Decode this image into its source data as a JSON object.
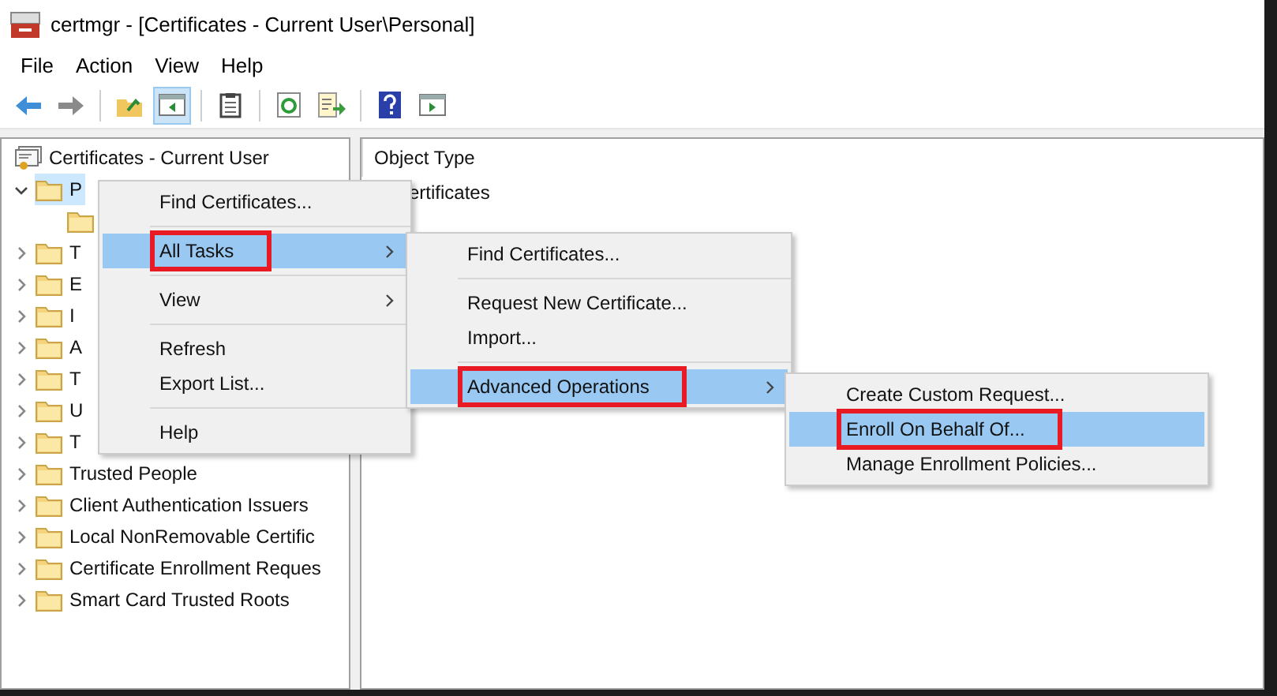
{
  "window": {
    "title": "certmgr - [Certificates - Current User\\Personal]"
  },
  "menu_bar": [
    "File",
    "Action",
    "View",
    "Help"
  ],
  "toolbar": [
    {
      "pressed": false
    },
    {
      "pressed": false
    },
    {
      "pressed": false
    },
    {
      "pressed": true
    },
    {
      "pressed": false
    },
    {
      "pressed": false
    },
    {
      "pressed": false
    },
    {
      "pressed": false
    },
    {
      "pressed": false
    }
  ],
  "tree": {
    "label": "Certificates - Current User",
    "children": [
      {
        "label": "P",
        "expanded": true,
        "selected": true,
        "children": [
          {
            "selected": false
          }
        ]
      },
      {
        "label": "T",
        "expanded": false,
        "selected": false
      },
      {
        "label": "E",
        "expanded": false,
        "selected": false
      },
      {
        "label": "I",
        "expanded": false,
        "selected": false
      },
      {
        "label": "A",
        "expanded": false,
        "selected": false
      },
      {
        "label": "T",
        "expanded": false,
        "selected": false
      },
      {
        "label": "U",
        "expanded": false,
        "selected": false
      },
      {
        "label": "T",
        "expanded": false,
        "selected": false
      },
      {
        "label": "Trusted People",
        "expanded": false,
        "selected": false
      },
      {
        "label": "Client Authentication Issuers",
        "expanded": false,
        "selected": false
      },
      {
        "label": "Local NonRemovable Certific",
        "expanded": false,
        "selected": false
      },
      {
        "label": "Certificate Enrollment Reques",
        "expanded": false,
        "selected": false
      },
      {
        "label": "Smart Card Trusted Roots",
        "expanded": false,
        "selected": false
      }
    ]
  },
  "details": {
    "column": "Object Type",
    "rows": [
      "ertificates"
    ]
  },
  "context_menus": [
    {
      "items": [
        {
          "kind": "item",
          "label": "Find Certificates...",
          "submenu": false,
          "selected": false,
          "annotated": false
        },
        {
          "kind": "separator"
        },
        {
          "kind": "item",
          "label": "All Tasks",
          "submenu": true,
          "selected": true,
          "annotated": true
        },
        {
          "kind": "separator"
        },
        {
          "kind": "item",
          "label": "View",
          "submenu": true,
          "selected": false,
          "annotated": false
        },
        {
          "kind": "separator"
        },
        {
          "kind": "item",
          "label": "Refresh",
          "submenu": false,
          "selected": false,
          "annotated": false
        },
        {
          "kind": "item",
          "label": "Export List...",
          "submenu": false,
          "selected": false,
          "annotated": false
        },
        {
          "kind": "separator"
        },
        {
          "kind": "item",
          "label": "Help",
          "submenu": false,
          "selected": false,
          "annotated": false
        }
      ]
    },
    {
      "items": [
        {
          "kind": "item",
          "label": "Find Certificates...",
          "submenu": false,
          "selected": false,
          "annotated": false
        },
        {
          "kind": "separator"
        },
        {
          "kind": "item",
          "label": "Request New Certificate...",
          "submenu": false,
          "selected": false,
          "annotated": false
        },
        {
          "kind": "item",
          "label": "Import...",
          "submenu": false,
          "selected": false,
          "annotated": false
        },
        {
          "kind": "separator"
        },
        {
          "kind": "item",
          "label": "Advanced Operations",
          "submenu": true,
          "selected": true,
          "annotated": true
        }
      ]
    },
    {
      "items": [
        {
          "kind": "item",
          "label": "Create Custom Request...",
          "submenu": false,
          "selected": false,
          "annotated": false
        },
        {
          "kind": "item",
          "label": "Enroll On Behalf Of...",
          "submenu": false,
          "selected": true,
          "annotated": true
        },
        {
          "kind": "item",
          "label": "Manage Enrollment Policies...",
          "submenu": false,
          "selected": false,
          "annotated": false
        }
      ]
    }
  ]
}
